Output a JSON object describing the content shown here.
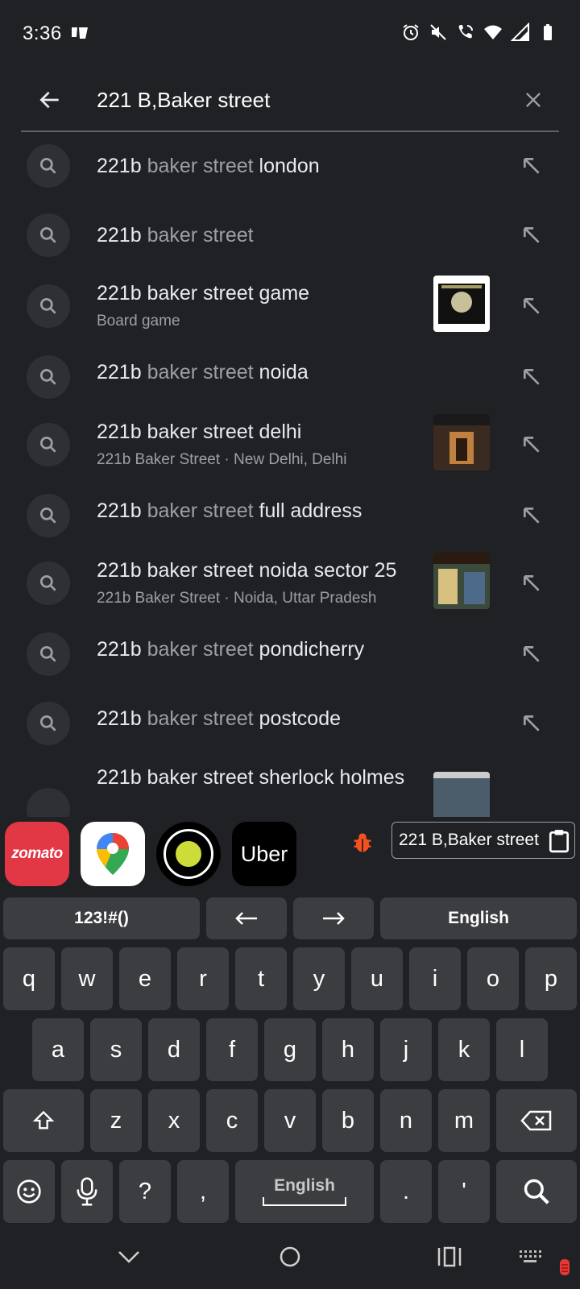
{
  "status_bar": {
    "time": "3:36",
    "icons": [
      "paytm-icon",
      "alarm-icon",
      "mute-icon",
      "wifi-call-icon",
      "wifi-icon",
      "signal-icon",
      "battery-icon"
    ]
  },
  "search": {
    "value": "221 B,Baker street",
    "back_icon": "arrow-left-icon",
    "clear_icon": "close-icon"
  },
  "suggestions": [
    {
      "bold": "221b",
      "dim": "baker street",
      "rest": "london",
      "sub": "",
      "thumb": ""
    },
    {
      "bold": "221b",
      "dim": "baker street",
      "rest": "",
      "sub": "",
      "thumb": ""
    },
    {
      "full": "221b baker street game",
      "sub": "Board game",
      "thumb": "board-game"
    },
    {
      "bold": "221b",
      "dim": "baker street",
      "rest": "noida",
      "sub": "",
      "thumb": ""
    },
    {
      "full": "221b baker street delhi",
      "sub": "221b Baker Street · New Delhi, Delhi",
      "thumb": "delhi-store"
    },
    {
      "bold": "221b",
      "dim": "baker street",
      "rest": "full address",
      "sub": "",
      "thumb": ""
    },
    {
      "full": "221b baker street noida sector 25",
      "sub": "221b Baker Street · Noida, Uttar Pradesh",
      "thumb": "noida-store"
    },
    {
      "bold": "221b",
      "dim": "baker street",
      "rest": "pondicherry",
      "sub": "",
      "thumb": ""
    },
    {
      "bold": "221b",
      "dim": "baker street",
      "rest": "postcode",
      "sub": "",
      "thumb": ""
    },
    {
      "full": "221b baker street sherlock holmes",
      "sub": "",
      "thumb": "sherlock"
    }
  ],
  "app_suggestions": [
    {
      "name": "zomato",
      "label": "zomato"
    },
    {
      "name": "google-maps",
      "label": ""
    },
    {
      "name": "ola",
      "label": ""
    },
    {
      "name": "uber",
      "label": "Uber"
    }
  ],
  "clipboard": {
    "text": "221 B,Baker street"
  },
  "keyboard": {
    "top_row": {
      "symbols": "123!#()",
      "lang": "English"
    },
    "row1": [
      "q",
      "w",
      "e",
      "r",
      "t",
      "y",
      "u",
      "i",
      "o",
      "p"
    ],
    "row2": [
      "a",
      "s",
      "d",
      "f",
      "g",
      "h",
      "j",
      "k",
      "l"
    ],
    "row3": [
      "z",
      "x",
      "c",
      "v",
      "b",
      "n",
      "m"
    ],
    "bottom": {
      "question": "?",
      "comma": ",",
      "space": "English",
      "period": ".",
      "apostrophe": "'"
    }
  },
  "colors": {
    "bg": "#202124",
    "key": "#3c3d40",
    "dim_text": "#9aa0a6",
    "zomato": "#e23744",
    "bug": "#f4511e"
  }
}
